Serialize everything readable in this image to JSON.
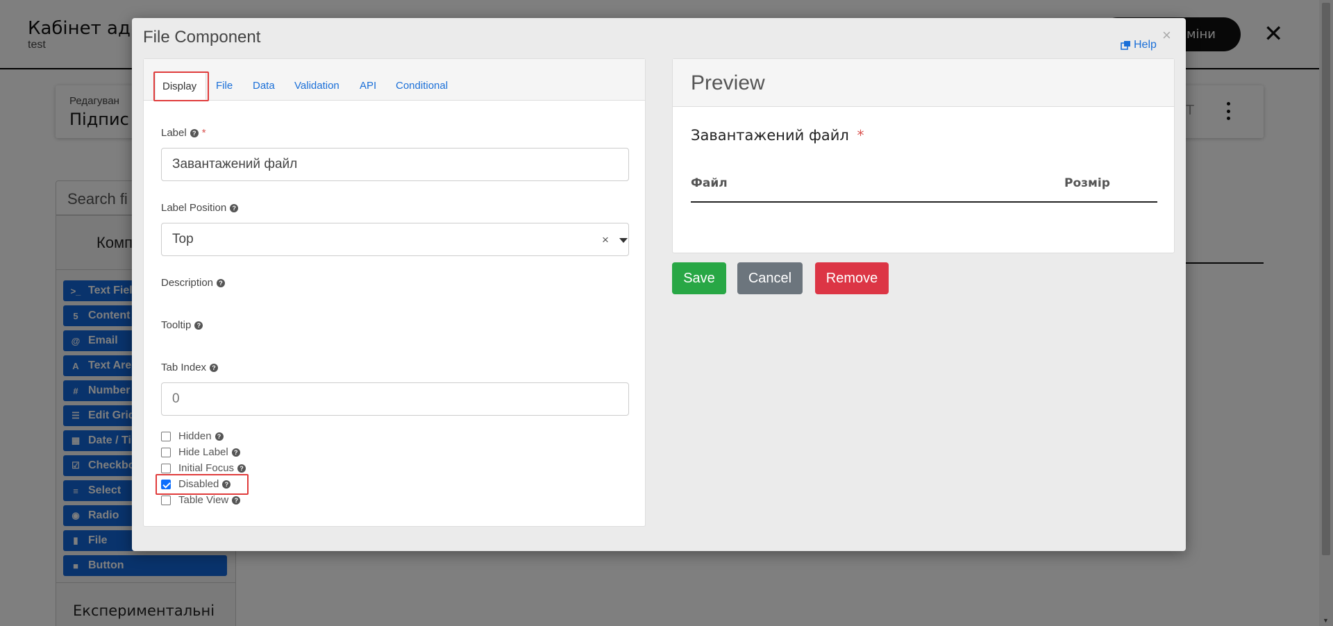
{
  "app": {
    "title": "Кабінет адм",
    "subtitle": "test",
    "save_button_label": "міни",
    "close_label": "✕"
  },
  "edit_card": {
    "small_label": "Редагуван",
    "title": "Підпис",
    "letter": "Т"
  },
  "sidebar": {
    "search_placeholder": "Search fi",
    "heading": "Комп",
    "components": [
      {
        "label": "Text Fiel",
        "icon": "terminal-icon",
        "glyph": ">_"
      },
      {
        "label": "Content",
        "icon": "html5-icon",
        "glyph": "5"
      },
      {
        "label": "Email",
        "icon": "at-icon",
        "glyph": "@"
      },
      {
        "label": "Text Are",
        "icon": "font-icon",
        "glyph": "A"
      },
      {
        "label": "Number",
        "icon": "hashtag-icon",
        "glyph": "#"
      },
      {
        "label": "Edit Grid",
        "icon": "tasks-icon",
        "glyph": "☰"
      },
      {
        "label": "Date / Ti",
        "icon": "calendar-icon",
        "glyph": "▦"
      },
      {
        "label": "Checkbo",
        "icon": "check-square-icon",
        "glyph": "☑"
      },
      {
        "label": "Select",
        "icon": "list-icon",
        "glyph": "≡"
      },
      {
        "label": "Radio",
        "icon": "dot-circle-icon",
        "glyph": "◉"
      },
      {
        "label": "File",
        "icon": "file-icon",
        "glyph": "▮"
      },
      {
        "label": "Button",
        "icon": "stop-icon",
        "glyph": "■"
      }
    ],
    "experimental_heading": "Експериментальні"
  },
  "modal": {
    "title": "File Component",
    "close_label": "×",
    "help_label": "Help",
    "tabs": [
      {
        "label": "Display",
        "active": true
      },
      {
        "label": "File"
      },
      {
        "label": "Data"
      },
      {
        "label": "Validation"
      },
      {
        "label": "API"
      },
      {
        "label": "Conditional"
      }
    ],
    "fields": {
      "label": {
        "label": "Label",
        "value": "Завантажений файл",
        "required_mark": "*"
      },
      "label_position": {
        "label": "Label Position",
        "value": "Top",
        "clear_label": "×"
      },
      "description": {
        "label": "Description"
      },
      "tooltip": {
        "label": "Tooltip"
      },
      "tab_index": {
        "label": "Tab Index",
        "placeholder": "0"
      }
    },
    "checkboxes": [
      {
        "label": "Hidden",
        "checked": false
      },
      {
        "label": "Hide Label",
        "checked": false
      },
      {
        "label": "Initial Focus",
        "checked": false
      },
      {
        "label": "Disabled",
        "checked": true
      },
      {
        "label": "Table View",
        "checked": false
      }
    ],
    "preview": {
      "heading": "Preview",
      "field_label": "Завантажений файл",
      "required_mark": "*",
      "col_file": "Файл",
      "col_size": "Розмір"
    },
    "buttons": {
      "save": "Save",
      "cancel": "Cancel",
      "remove": "Remove"
    }
  },
  "colors": {
    "accent": "#1266d8",
    "save": "#28a745",
    "cancel": "#6c757d",
    "remove": "#dc3545",
    "highlight": "#e03b3b"
  }
}
